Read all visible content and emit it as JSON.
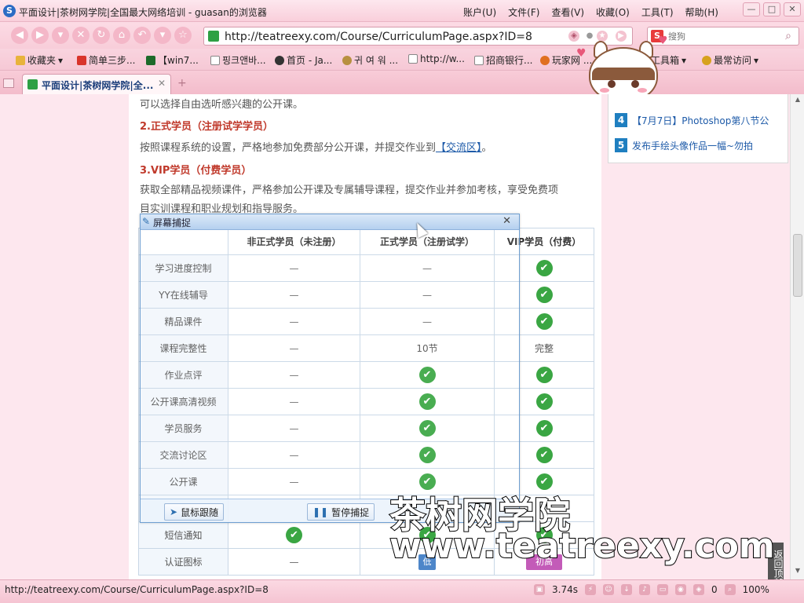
{
  "window": {
    "title": "平面设计|茶树网学院|全国最大网络培训 - guasan的浏览器",
    "menus": [
      "账户(U)",
      "文件(F)",
      "查看(V)",
      "收藏(O)",
      "工具(T)",
      "帮助(H)"
    ]
  },
  "address": {
    "url": "http://teatreexy.com/Course/CurriculumPage.aspx?ID=8"
  },
  "search": {
    "placeholder": "搜狗"
  },
  "bookmarks": [
    {
      "label": "收藏夹",
      "color": "#e8b33b"
    },
    {
      "label": "简单三步...",
      "color": "#d9342b"
    },
    {
      "label": "【win7...",
      "color": "#1d6a2a"
    },
    {
      "label": "핑크앤바...",
      "color": "#888888"
    },
    {
      "label": "首页 - Ja...",
      "color": "#333333"
    },
    {
      "label": "귀 여 워 ...",
      "color": "#b89040"
    },
    {
      "label": "http://w...",
      "color": "#aaaaaa"
    },
    {
      "label": "招商银行...",
      "color": "#888888"
    },
    {
      "label": "玩家网 ...",
      "color": "#e07020"
    },
    {
      "label": "工具箱",
      "color": "#cc6688"
    },
    {
      "label": "最常访问",
      "color": "#d7a21e"
    }
  ],
  "tab": {
    "label": "平面设计|茶树网学院|全..."
  },
  "content": {
    "intro": "可以选择自由选听感兴趣的公开课。",
    "heading2": "2.正式学员（注册试学学员）",
    "para2_pre": "按照课程系统的设置，严格地参加免费部分公开课，并提交作业到",
    "para2_link": "【交流区】",
    "para2_post": "。",
    "heading3": "3.VIP学员（付费学员）",
    "para3_line1": "获取全部精品视频课件，严格参加公开课及专属辅导课程，提交作业并参加考核，享受免费项",
    "para3_line2": "目实训课程和职业规划和指导服务。"
  },
  "table": {
    "headers": [
      "",
      "非正式学员（未注册）",
      "正式学员（注册试学）",
      "VIP学员（付费）"
    ],
    "rows": [
      {
        "label": "学习进度控制",
        "cells": [
          "—",
          "—",
          "✔"
        ]
      },
      {
        "label": "YY在线辅导",
        "cells": [
          "—",
          "—",
          "✔"
        ]
      },
      {
        "label": "精品课件",
        "cells": [
          "—",
          "—",
          "✔"
        ]
      },
      {
        "label": "课程完整性",
        "cells": [
          "—",
          "10节",
          "完整"
        ]
      },
      {
        "label": "作业点评",
        "cells": [
          "—",
          "✔",
          "✔"
        ]
      },
      {
        "label": "公开课高清视频",
        "cells": [
          "—",
          "✔",
          "✔"
        ]
      },
      {
        "label": "学员服务",
        "cells": [
          "—",
          "✔",
          "✔"
        ]
      },
      {
        "label": "交流讨论区",
        "cells": [
          "—",
          "✔",
          "✔"
        ]
      },
      {
        "label": "公开课",
        "cells": [
          "—",
          "✔",
          "✔"
        ]
      },
      {
        "label": "",
        "cells": [
          "",
          "",
          ""
        ]
      },
      {
        "label": "短信通知",
        "cells": [
          "✔",
          "✔",
          "✔"
        ]
      },
      {
        "label": "认证图标",
        "cells": [
          "—",
          "",
          ""
        ]
      }
    ],
    "badges": {
      "mid": "低",
      "right": "初高"
    }
  },
  "sidebar": {
    "items": [
      {
        "num": "4",
        "text": "【7月7日】Photoshop第八节公"
      },
      {
        "num": "5",
        "text": "发布手绘头像作品一幅~勿拍"
      }
    ]
  },
  "capture": {
    "title": "屏幕捕捉",
    "follow_label": "鼠标跟随",
    "pause_label": "暂停捕捉"
  },
  "watermark": {
    "line1": "茶树网学院",
    "line2": "www.teatreexy.com"
  },
  "backtop": {
    "label": "返回顶部"
  },
  "status": {
    "url": "http://teatreexy.com/Course/CurriculumPage.aspx?ID=8",
    "time": "3.74s",
    "count": "0",
    "zoom": "100%"
  },
  "colors": {
    "accent": "#e8587a",
    "check": "#3aa643",
    "heading": "#c0392b",
    "link": "#1d5aa8"
  }
}
